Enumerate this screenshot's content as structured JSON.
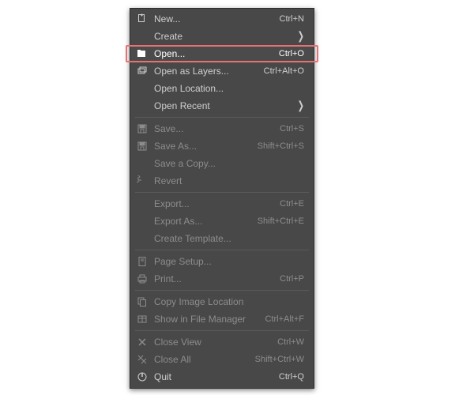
{
  "menu": {
    "groups": [
      [
        {
          "id": "new",
          "label": "New...",
          "shortcut": "Ctrl+N",
          "icon": "new-icon",
          "submenu": false,
          "enabled": true
        },
        {
          "id": "create",
          "label": "Create",
          "shortcut": "",
          "icon": "blank-icon",
          "submenu": true,
          "enabled": true
        },
        {
          "id": "open",
          "label": "Open...",
          "shortcut": "Ctrl+O",
          "icon": "open-icon",
          "submenu": false,
          "enabled": true,
          "hovered": true,
          "highlighted": true
        },
        {
          "id": "open-layers",
          "label": "Open as Layers...",
          "shortcut": "Ctrl+Alt+O",
          "icon": "layers-icon",
          "submenu": false,
          "enabled": true
        },
        {
          "id": "open-location",
          "label": "Open Location...",
          "shortcut": "",
          "icon": "blank-icon",
          "submenu": false,
          "enabled": true
        },
        {
          "id": "open-recent",
          "label": "Open Recent",
          "shortcut": "",
          "icon": "blank-icon",
          "submenu": true,
          "enabled": true
        }
      ],
      [
        {
          "id": "save",
          "label": "Save...",
          "shortcut": "Ctrl+S",
          "icon": "save-icon",
          "enabled": false
        },
        {
          "id": "save-as",
          "label": "Save As...",
          "shortcut": "Shift+Ctrl+S",
          "icon": "saveas-icon",
          "enabled": false
        },
        {
          "id": "save-copy",
          "label": "Save a Copy...",
          "shortcut": "",
          "icon": "blank-icon",
          "enabled": false
        },
        {
          "id": "revert",
          "label": "Revert",
          "shortcut": "",
          "icon": "revert-icon",
          "enabled": false
        }
      ],
      [
        {
          "id": "export",
          "label": "Export...",
          "shortcut": "Ctrl+E",
          "icon": "blank-icon",
          "enabled": false
        },
        {
          "id": "export-as",
          "label": "Export As...",
          "shortcut": "Shift+Ctrl+E",
          "icon": "blank-icon",
          "enabled": false
        },
        {
          "id": "create-tmpl",
          "label": "Create Template...",
          "shortcut": "",
          "icon": "blank-icon",
          "enabled": false
        }
      ],
      [
        {
          "id": "page-setup",
          "label": "Page Setup...",
          "shortcut": "",
          "icon": "pagesetup-icon",
          "enabled": false
        },
        {
          "id": "print",
          "label": "Print...",
          "shortcut": "Ctrl+P",
          "icon": "print-icon",
          "enabled": false
        }
      ],
      [
        {
          "id": "copy-loc",
          "label": "Copy Image Location",
          "shortcut": "",
          "icon": "copy-icon",
          "enabled": false
        },
        {
          "id": "show-fm",
          "label": "Show in File Manager",
          "shortcut": "Ctrl+Alt+F",
          "icon": "filemgr-icon",
          "enabled": false
        }
      ],
      [
        {
          "id": "close-view",
          "label": "Close View",
          "shortcut": "Ctrl+W",
          "icon": "close-icon",
          "enabled": false
        },
        {
          "id": "close-all",
          "label": "Close All",
          "shortcut": "Shift+Ctrl+W",
          "icon": "closeall-icon",
          "enabled": false
        },
        {
          "id": "quit",
          "label": "Quit",
          "shortcut": "Ctrl+Q",
          "icon": "quit-icon",
          "enabled": true
        }
      ]
    ],
    "submenu_glyph": "❯"
  }
}
